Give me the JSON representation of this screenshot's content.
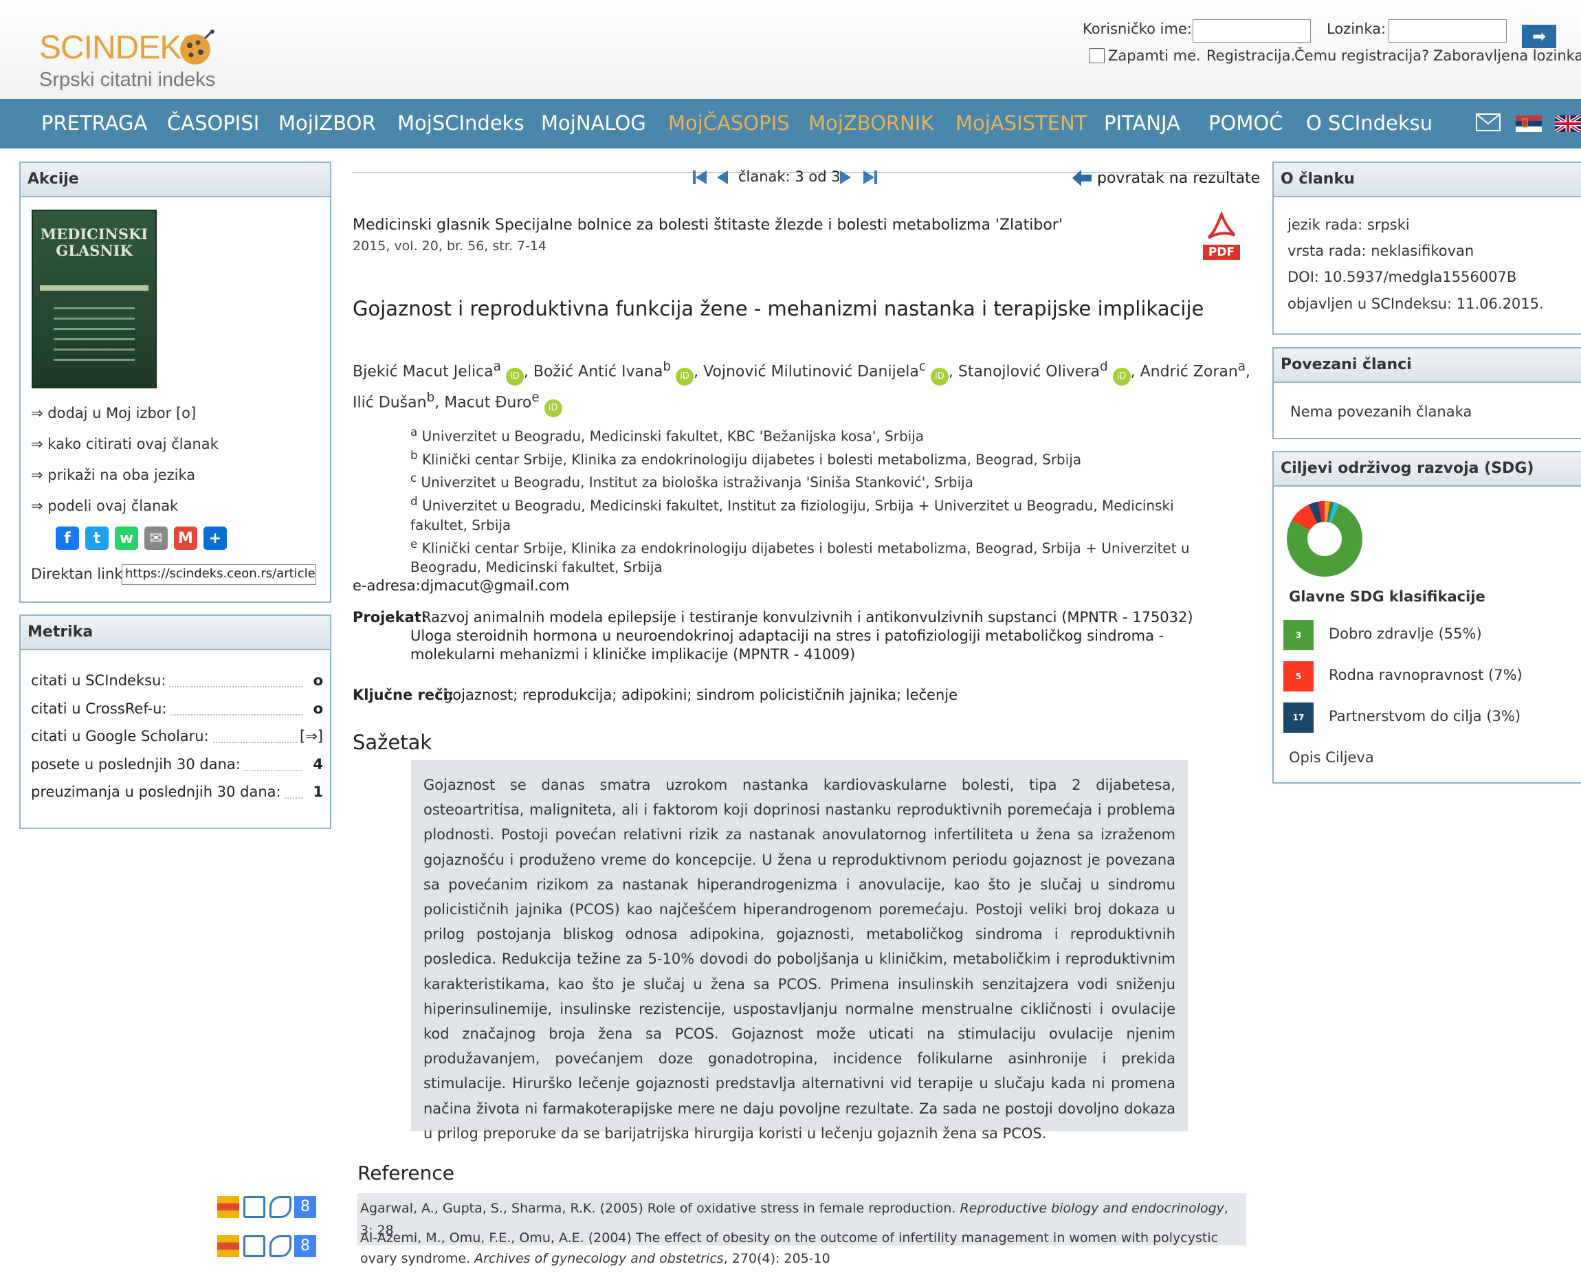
{
  "logo": {
    "title": "SCINDEKS",
    "subtitle": "Srpski citatni indeks"
  },
  "login": {
    "username_label": "Korisničko ime:",
    "username_value": "",
    "password_label": "Lozinka:",
    "password_value": "",
    "submit": "➡",
    "remember_label": "Zapamti me.",
    "links": [
      "Registracija.",
      "Čemu registracija?",
      "Zaboravljena lozinka!"
    ]
  },
  "nav": {
    "items": [
      "PRETRAGA",
      "ČASOPISI",
      "MojIZBOR",
      "MojSCIndeks",
      "MojNALOG",
      "MojČASOPIS",
      "MojZBORNIK",
      "MojASISTENT",
      "PITANJA",
      "POMOĆ",
      "O SCIndeksu"
    ]
  },
  "actions": {
    "title": "Akcije",
    "cover_title": "MEDICINSKI GLASNIK",
    "links": [
      "⇒ dodaj u Moj izbor [o]",
      "⇒ kako citirati ovaj članak",
      "⇒ prikaži na oba jezika",
      "⇒ podeli ovaj članak"
    ],
    "direct_link_label": "Direktan link",
    "direct_link_value": "https://scindeks.ceon.rs/article"
  },
  "metrics": {
    "title": "Metrika",
    "rows": [
      {
        "label": "citati u SCIndeksu:",
        "value": "o"
      },
      {
        "label": "citati u CrossRef-u:",
        "value": "o"
      },
      {
        "label": "citati u Google Scholaru:",
        "value": "[⇒]"
      },
      {
        "label": "posete u poslednjih 30 dana:",
        "value": "4"
      },
      {
        "label": "preuzimanja u poslednjih 30 dana:",
        "value": "1"
      }
    ]
  },
  "pager": {
    "label": "članak: 3 od 3",
    "back": "povratak na rezultate"
  },
  "article": {
    "journal": "Medicinski glasnik Specijalne bolnice za bolesti štitaste žlezde i bolesti metabolizma 'Zlatibor'",
    "issue": "2015, vol. 20, br. 56, str. 7-14",
    "pdf_label": "PDF",
    "title": "Gojaznost i reproduktivna funkcija žene - mehanizmi nastanka i terapijske implikacije",
    "authors": [
      {
        "name": "Bjekić Macut Jelica",
        "sup": "a",
        "orcid": true
      },
      {
        "name": "Božić Antić Ivana",
        "sup": "b",
        "orcid": true
      },
      {
        "name": "Vojnović Milutinović Danijela",
        "sup": "c",
        "orcid": true
      },
      {
        "name": "Stanojlović Olivera",
        "sup": "d",
        "orcid": true
      },
      {
        "name": "Andrić Zoran",
        "sup": "a",
        "orcid": false
      },
      {
        "name": "Ilić Dušan",
        "sup": "b",
        "orcid": false
      },
      {
        "name": "Macut Đuro",
        "sup": "e",
        "orcid": true
      }
    ],
    "affiliations": [
      {
        "sup": "a",
        "lines": [
          "Univerzitet u Beogradu, Medicinski fakultet, KBC 'Bežanijska kosa', Srbija"
        ]
      },
      {
        "sup": "b",
        "lines": [
          "Klinički centar Srbije, Klinika za endokrinologiju dijabetes i bolesti metabolizma, Beograd, Srbija"
        ]
      },
      {
        "sup": "c",
        "lines": [
          "Univerzitet u Beogradu, Institut za biološka istraživanja 'Siniša Stanković', Srbija"
        ]
      },
      {
        "sup": "d",
        "lines": [
          "Univerzitet u Beogradu, Medicinski fakultet, Institut za fiziologiju, Srbija + Univerzitet u Beogradu, Medicinski",
          "fakultet, Srbija"
        ]
      },
      {
        "sup": "e",
        "lines": [
          "Klinički centar Srbije, Klinika za endokrinologiju dijabetes i bolesti metabolizma, Beograd, Srbija + Univerzitet u",
          "Beogradu, Medicinski fakultet, Srbija"
        ]
      }
    ],
    "email_label": "e-adresa:",
    "email": "djmacut@gmail.com",
    "project_label": "Projekat:",
    "project_lines": [
      "Razvoj animalnih modela epilepsije i testiranje konvulzivnih i antikonvulzivnih supstanci (MPNTR - 175032)",
      "Uloga steroidnih hormona u neuroendokrinoj adaptaciji na stres i patofiziologiji metaboličkog sindroma -",
      "molekularni mehanizmi i kliničke implikacije (MPNTR - 41009)"
    ],
    "keywords_label": "Ključne reči:",
    "keywords": "gojaznost; reprodukcija; adipokini; sindrom policističnih jajnika; lečenje",
    "abstract_heading": "Sažetak",
    "abstract": "Gojaznost se danas smatra uzrokom nastanka kardiovaskularne bolesti, tipa 2 dijabetesa, osteoartritisa, maligniteta, ali i faktorom koji doprinosi nastanku reproduktivnih poremećaja i problema plodnosti. Postoji povećan relativni rizik za nastanak anovulatornog infertiliteta u žena sa izraženom gojaznošću i produženo vreme do koncepcije. U žena u reproduktivnom periodu gojaznost je povezana sa povećanim rizikom za nastanak hiperandrogenizma i anovulacije, kao što je slučaj u sindromu policističnih jajnika (PCOS) kao najčešćem hiperandrogenom poremećaju. Postoji veliki broj dokaza u prilog postojanja bliskog odnosa adipokina, gojaznosti, metaboličkog sindroma i reproduktivnih posledica. Redukcija težine za 5-10% dovodi do poboljšanja u kliničkim, metaboličkim i reproduktivnim karakteristikama, kao što je slučaj u žena sa PCOS. Primena insulinskih senzitajzera vodi sniženju hiperinsulinemije, insulinske rezistencije, uspostavljanju normalne menstrualne cikličnosti i ovulacije kod značajnog broja žena sa PCOS. Gojaznost može uticati na stimulaciju ovulacije njenim produžavanjem, povećanjem doze gonadotropina, incidence folikularne asinhronije i prekida stimulacije. Hirurško lečenje gojaznosti predstavlja alternativni vid terapije u slučaju kada ni promena načina života ni farmakoterapijske mere ne daju povoljne rezultate. Za sada ne postoji dovoljno dokaza u prilog preporuke da se barijatrijska hirurgija koristi u lečenju gojaznih žena sa PCOS.",
    "references_heading": "Reference",
    "references": [
      {
        "text": "Agarwal, A., Gupta, S., Sharma, R.K. (2005) Role of oxidative stress in female reproduction.",
        "journal": "Reproductive biology and endocrinology",
        "rest": ", 3: 28"
      },
      {
        "text": "Al-Azemi, M., Omu, F.E., Omu, A.E. (2004) The effect of obesity on the outcome of infertility management in women with polycystic ovary syndrome.",
        "journal": "Archives of gynecology and obstetrics",
        "rest": ", 270(4): 205-10"
      }
    ]
  },
  "about": {
    "title": "O članku",
    "rows": [
      "jezik rada: srpski",
      "vrsta rada: neklasifikovan",
      "DOI: 10.5937/medgla1556007B",
      "objavljen u SCIndeksu: 11.06.2015."
    ]
  },
  "related": {
    "title": "Povezani članci",
    "empty": "Nema povezanih članaka"
  },
  "sdg": {
    "title": "Ciljevi održivog razvoja (SDG)",
    "main_label": "Glavne SDG klasifikacije",
    "items": [
      {
        "label": "Dobro zdravlje (55%)",
        "color": "#4c9f38",
        "num": "3"
      },
      {
        "label": "Rodna ravnopravnost (7%)",
        "color": "#ff3a21",
        "num": "5"
      },
      {
        "label": "Partnerstvom do cilja (3%)",
        "color": "#19486a",
        "num": "17"
      }
    ],
    "footer": "Opis Ciljeva"
  }
}
